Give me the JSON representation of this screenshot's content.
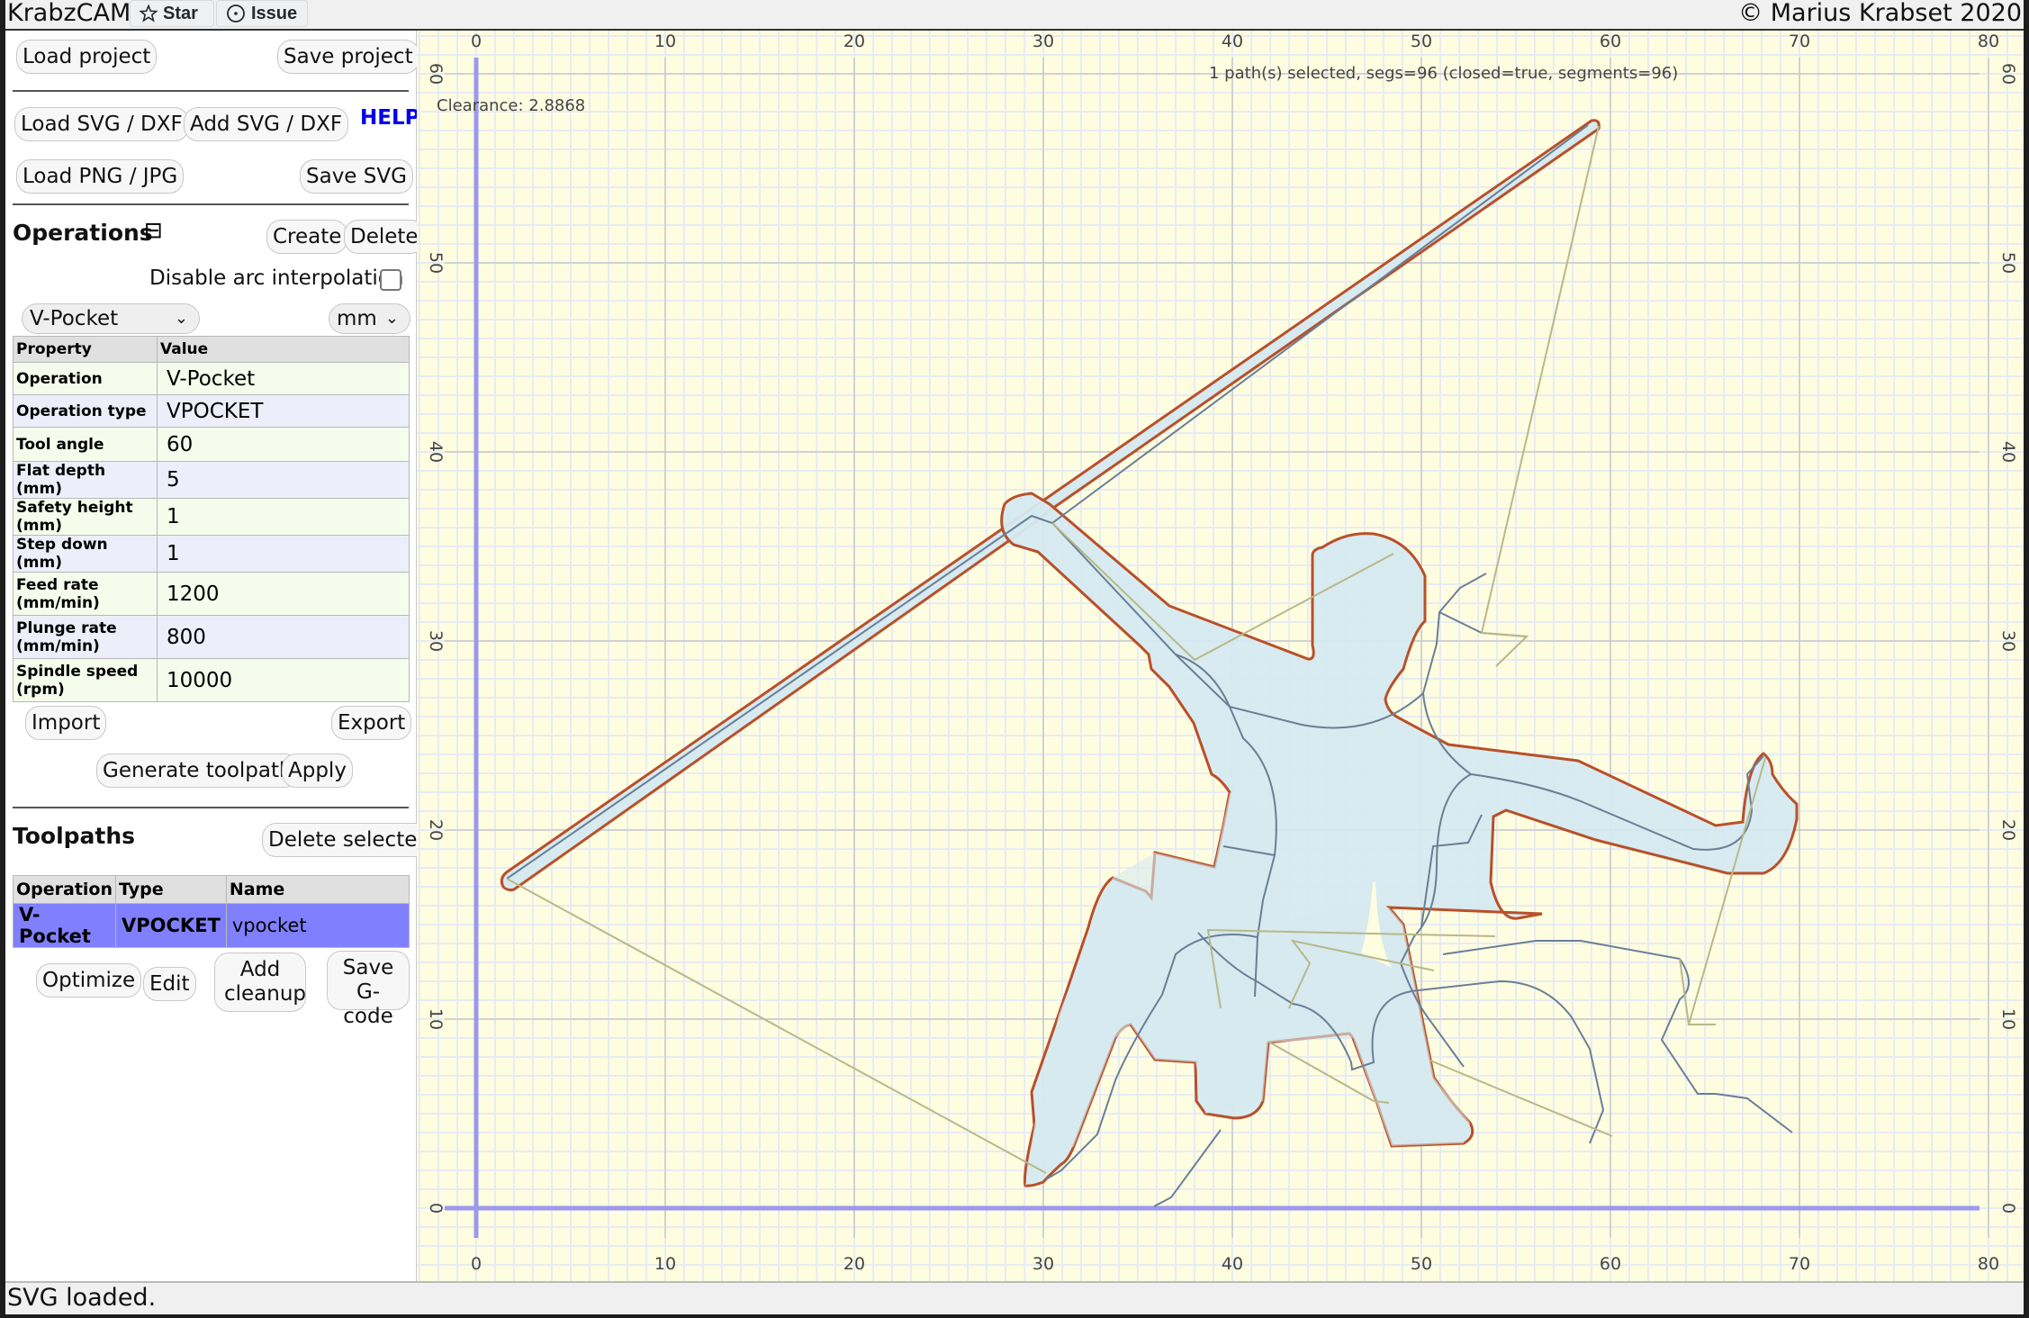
{
  "app": {
    "title": "KrabzCAM",
    "copyright": "© Marius Krabset 2020",
    "github": {
      "star_label": "Star",
      "issue_label": "Issue"
    }
  },
  "sidebar": {
    "load_project": "Load project",
    "save_project": "Save project",
    "load_svg": "Load SVG / DXF",
    "add_svg": "Add SVG / DXF",
    "help": "HELP",
    "load_png": "Load PNG / JPG",
    "save_svg": "Save SVG",
    "operations": {
      "title": "Operations",
      "collapse_icon": "⊟",
      "create": "Create",
      "delete": "Delete",
      "disable_arc_label": "Disable arc interpolation",
      "disable_arc_checked": false,
      "operation_select": "V-Pocket",
      "unit_select": "mm",
      "table_headers": [
        "Property",
        "Value"
      ],
      "properties": [
        {
          "name": "Operation",
          "value": "V-Pocket"
        },
        {
          "name": "Operation type",
          "value": "VPOCKET"
        },
        {
          "name": "Tool angle",
          "value": "60"
        },
        {
          "name": "Flat depth (mm)",
          "value": "5"
        },
        {
          "name": "Safety height (mm)",
          "value": "1"
        },
        {
          "name": "Step down (mm)",
          "value": "1"
        },
        {
          "name": "Feed rate (mm/min)",
          "value": "1200"
        },
        {
          "name": "Plunge rate (mm/min)",
          "value": "800"
        },
        {
          "name": "Spindle speed (rpm)",
          "value": "10000"
        }
      ],
      "import": "Import",
      "export": "Export",
      "generate_toolpath": "Generate toolpath",
      "apply": "Apply"
    },
    "toolpaths": {
      "title": "Toolpaths",
      "delete_selected": "Delete selected",
      "headers": [
        "Operation",
        "Type",
        "Name"
      ],
      "rows": [
        {
          "operation": "V-Pocket",
          "type": "VPOCKET",
          "name": "vpocket",
          "selected": true
        }
      ],
      "optimize": "Optimize",
      "edit": "Edit",
      "add_cleanup": "Add cleanup",
      "save_gcode": "Save G-code"
    }
  },
  "canvas": {
    "selection_info": "1 path(s) selected, segs=96 (closed=true, segments=96)",
    "clearance": "Clearance: 2.8868",
    "x_ticks": [
      "0",
      "10",
      "20",
      "30",
      "40",
      "50",
      "60",
      "70",
      "80"
    ],
    "y_ticks": [
      "0",
      "10",
      "20",
      "30",
      "40",
      "50",
      "60"
    ],
    "colors": {
      "background": "#fffde0",
      "grid_minor": "#e6ecf4",
      "grid_major": "#c9c9c9",
      "axis": "#9999ee",
      "shape_fill": "#d6eaf0",
      "shape_stroke": "#b8502a",
      "toolpath": "#6a7f96",
      "rapid": "#b8b888"
    }
  },
  "status": {
    "text": "SVG loaded."
  }
}
